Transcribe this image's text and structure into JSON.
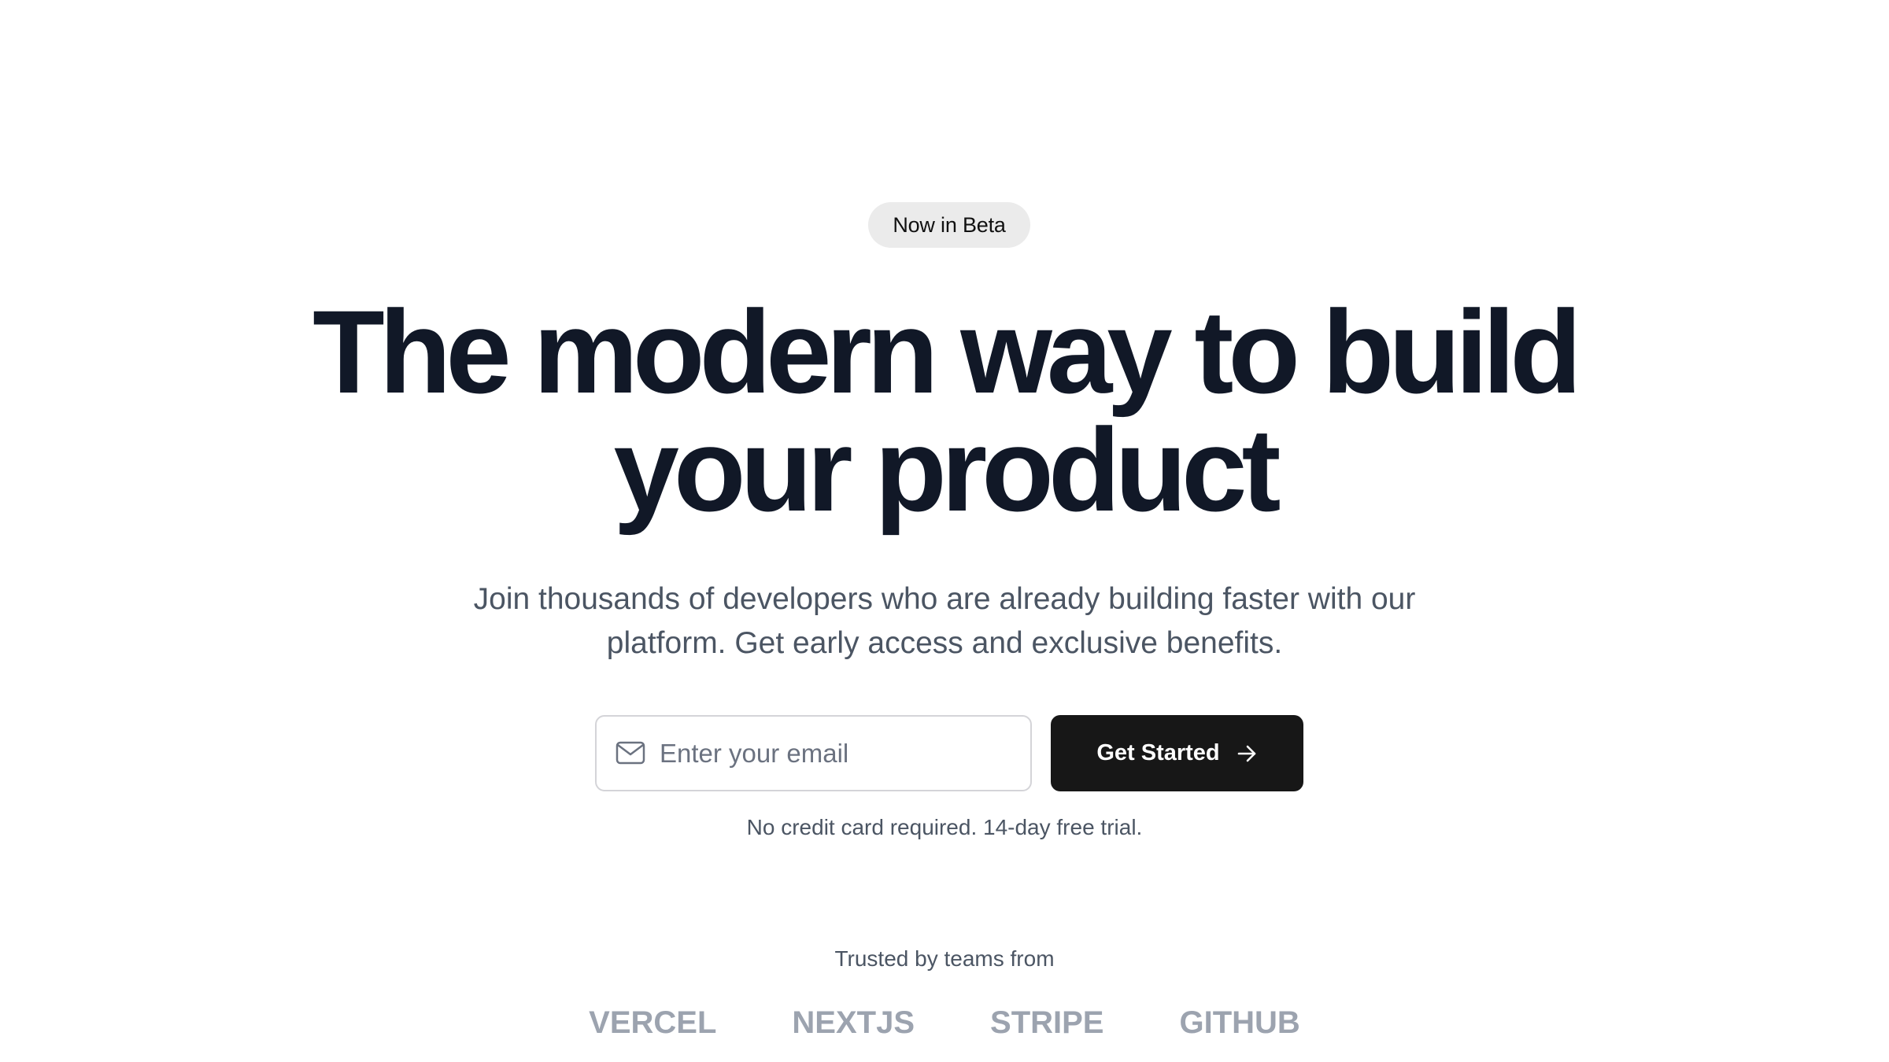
{
  "hero": {
    "badge": "Now in Beta",
    "headline_line1": "The modern way to build",
    "headline_line2": "your product",
    "subtitle_line1": "Join thousands of developers who are already building faster with our",
    "subtitle_line2": "platform. Get early access and exclusive benefits."
  },
  "signup": {
    "email_placeholder": "Enter your email",
    "email_value": "",
    "email_icon": "mail-icon",
    "cta_label": "Get Started",
    "cta_icon": "arrow-right-icon",
    "fineprint": "No credit card required. 14-day free trial."
  },
  "trusted": {
    "label": "Trusted by teams from",
    "logos": [
      "VERCEL",
      "NEXTJS",
      "STRIPE",
      "GITHUB"
    ]
  },
  "colors": {
    "headline": "#111827",
    "body_text": "#4b5563",
    "cta_background": "#171717",
    "badge_background": "#ebebeb",
    "logo_text": "#9ca3af"
  }
}
